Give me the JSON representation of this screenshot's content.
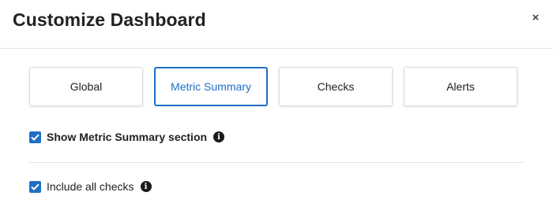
{
  "dialog": {
    "title": "Customize Dashboard",
    "close_glyph": "×"
  },
  "tabs": [
    {
      "label": "Global",
      "active": false
    },
    {
      "label": "Metric Summary",
      "active": true
    },
    {
      "label": "Checks",
      "active": false
    },
    {
      "label": "Alerts",
      "active": false
    }
  ],
  "options": [
    {
      "label": "Show Metric Summary section",
      "checked": true,
      "icon": "info-icon"
    },
    {
      "label": "Include all checks",
      "checked": true,
      "icon": "info-icon"
    }
  ],
  "colors": {
    "accent": "#1f6fc5",
    "info_icon": "#1a1a1a"
  },
  "icons": {
    "info_glyph": "i"
  }
}
